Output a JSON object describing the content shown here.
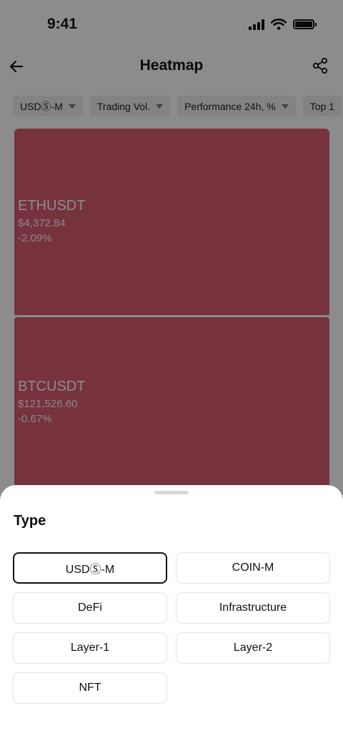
{
  "status_bar": {
    "time": "9:41"
  },
  "nav": {
    "title": "Heatmap"
  },
  "filters": [
    {
      "label": "USDⓈ-M"
    },
    {
      "label": "Trading Vol."
    },
    {
      "label": "Performance 24h, %"
    },
    {
      "label": "Top 1"
    }
  ],
  "heatmap": {
    "tiles": [
      {
        "symbol": "ETHUSDT",
        "price": "$4,372.84",
        "change": "-2.09%"
      },
      {
        "symbol": "BTCUSDT",
        "price": "$121,526.60",
        "change": "-0.67%"
      }
    ],
    "color_negative": "#d85c70"
  },
  "sheet": {
    "title": "Type",
    "options": [
      {
        "label": "USDⓈ-M",
        "selected": true
      },
      {
        "label": "COIN-M",
        "selected": false
      },
      {
        "label": "DeFi",
        "selected": false
      },
      {
        "label": "Infrastructure",
        "selected": false
      },
      {
        "label": "Layer-1",
        "selected": false
      },
      {
        "label": "Layer-2",
        "selected": false
      },
      {
        "label": "NFT",
        "selected": false
      }
    ]
  },
  "icons": {
    "back": "arrow-left-icon",
    "share": "share-icon",
    "signal": "cellular-signal-icon",
    "wifi": "wifi-icon",
    "battery": "battery-icon",
    "caret": "caret-down-icon"
  }
}
